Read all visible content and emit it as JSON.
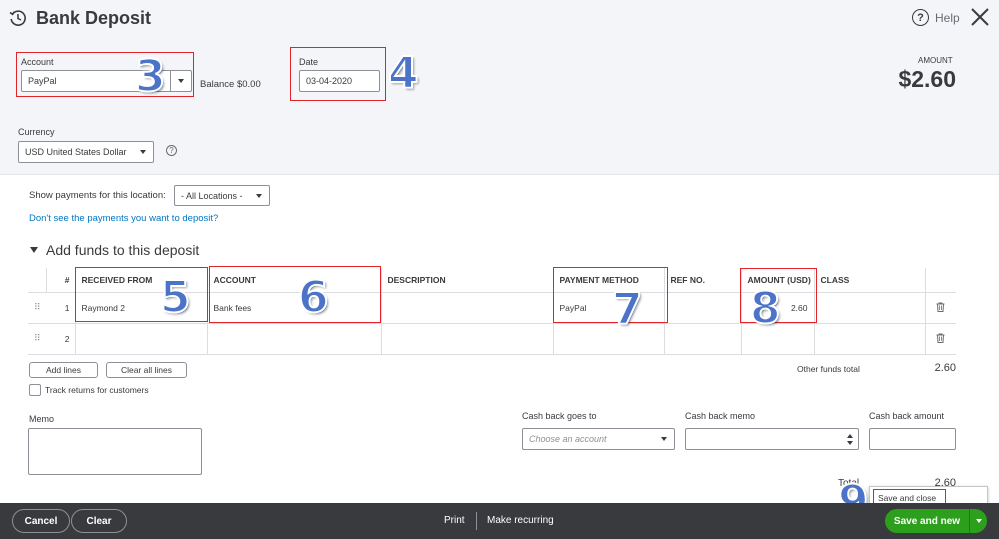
{
  "header": {
    "title": "Bank Deposit",
    "help": "Help",
    "amount_label": "AMOUNT",
    "amount_value": "$2.60"
  },
  "account": {
    "label": "Account",
    "value": "PayPal",
    "balance": "Balance $0.00"
  },
  "date": {
    "label": "Date",
    "value": "03-04-2020"
  },
  "currency": {
    "label": "Currency",
    "value": "USD United States Dollar"
  },
  "location": {
    "label": "Show payments for this location:",
    "value": "- All Locations -"
  },
  "payments_link": "Don't see the payments you want to deposit?",
  "funds_section": "Add funds to this deposit",
  "table": {
    "headers": [
      "#",
      "RECEIVED FROM",
      "ACCOUNT",
      "DESCRIPTION",
      "PAYMENT METHOD",
      "REF NO.",
      "AMOUNT (USD)",
      "CLASS"
    ],
    "rows": [
      {
        "num": "1",
        "received_from": "Raymond 2",
        "account": "Bank fees",
        "description": "",
        "payment_method": "PayPal",
        "ref_no": "",
        "amount": "2.60",
        "class": ""
      },
      {
        "num": "2",
        "received_from": "",
        "account": "",
        "description": "",
        "payment_method": "",
        "ref_no": "",
        "amount": "",
        "class": ""
      }
    ]
  },
  "buttons": {
    "add_lines": "Add lines",
    "clear_all_lines": "Clear all lines"
  },
  "track_returns": "Track returns for customers",
  "other_funds": {
    "label": "Other funds total",
    "value": "2.60"
  },
  "memo": {
    "label": "Memo"
  },
  "cash_back": {
    "goes_to_label": "Cash back goes to",
    "goes_to_placeholder": "Choose an account",
    "memo_label": "Cash back memo",
    "amount_label": "Cash back amount"
  },
  "total": {
    "label": "Total",
    "value": "2.60"
  },
  "save_dropdown": {
    "option": "Save and close"
  },
  "footer": {
    "cancel": "Cancel",
    "clear": "Clear",
    "print": "Print",
    "make_recurring": "Make recurring",
    "save_and_new": "Save and new"
  },
  "annotations": [
    "3",
    "4",
    "5",
    "6",
    "7",
    "8",
    "9"
  ],
  "colors": {
    "accent_green": "#2ca01c",
    "link_blue": "#0077c5",
    "annotation_red": "#e2242a",
    "annotation_blue": "#4c73c7",
    "footer_dark": "#393a3d"
  }
}
